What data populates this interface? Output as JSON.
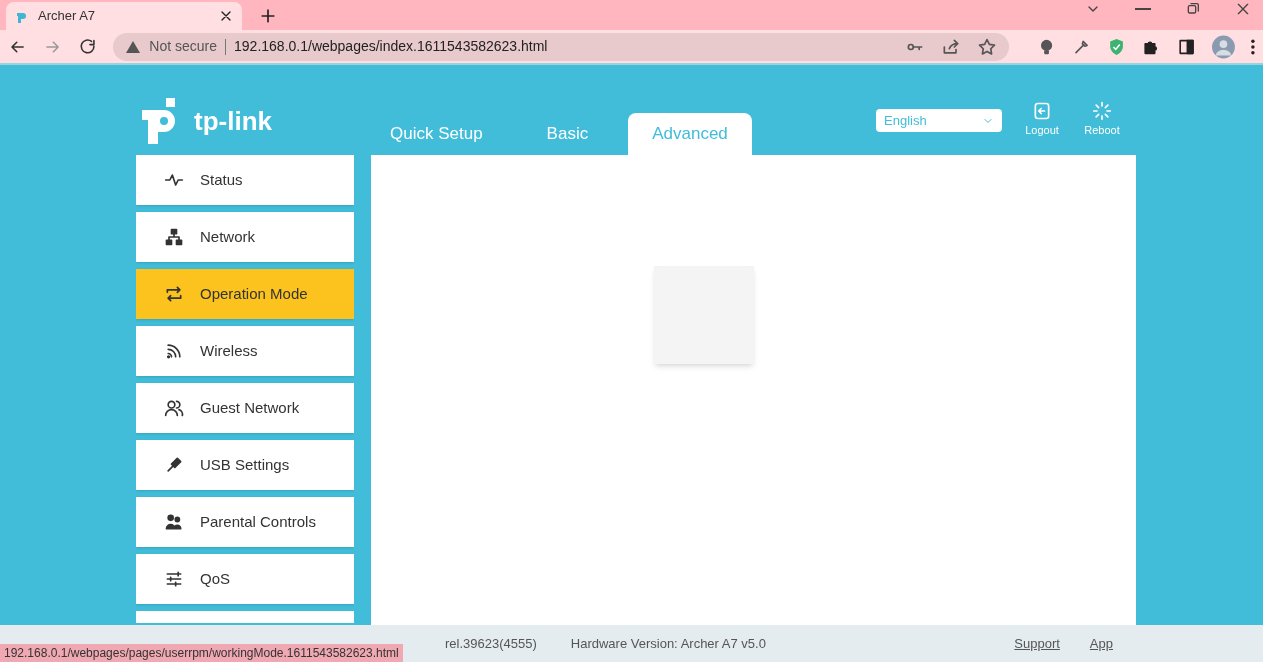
{
  "browser": {
    "tab_title": "Archer A7",
    "address_warning": "Not secure",
    "url": "192.168.0.1/webpages/index.1611543582623.html",
    "status_url": "192.168.0.1/webpages/pages/userrpm/workingMode.1611543582623.html"
  },
  "header": {
    "logo": "tp-link",
    "language": "English",
    "actions": [
      {
        "label": "Logout",
        "kind": "logout"
      },
      {
        "label": "Reboot",
        "kind": "reboot"
      }
    ]
  },
  "nav_tabs": [
    {
      "label": "Quick Setup",
      "selected": false
    },
    {
      "label": "Basic",
      "selected": false
    },
    {
      "label": "Advanced",
      "selected": true
    }
  ],
  "sidebar": {
    "items": [
      {
        "label": "Status",
        "kind": "status",
        "selected": false
      },
      {
        "label": "Network",
        "kind": "network",
        "selected": false
      },
      {
        "label": "Operation Mode",
        "kind": "mode",
        "selected": true
      },
      {
        "label": "Wireless",
        "kind": "wireless",
        "selected": false
      },
      {
        "label": "Guest Network",
        "kind": "guest",
        "selected": false
      },
      {
        "label": "USB Settings",
        "kind": "usb",
        "selected": false
      },
      {
        "label": "Parental Controls",
        "kind": "parental",
        "selected": false
      },
      {
        "label": "QoS",
        "kind": "qos",
        "selected": false
      }
    ]
  },
  "footer": {
    "firmware": "rel.39623(4555)",
    "hardware": "Hardware Version: Archer A7 v5.0",
    "links": [
      "Support",
      "App"
    ]
  }
}
